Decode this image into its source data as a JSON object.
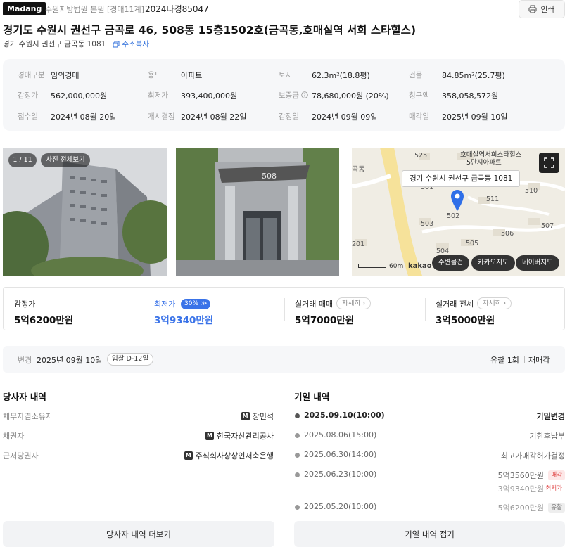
{
  "header": {
    "brand": "Madang",
    "court": "수원지방법원 본원 [경매11계]",
    "case_number": "2024타경85047",
    "print_label": "인쇄"
  },
  "property": {
    "title": "경기도 수원시 권선구 금곡로 46, 508동 15층1502호(금곡동,호매실역 서희 스타힐스)",
    "lot_address": "경기 수원시 권선구 금곡동 1081",
    "copy_label": "주소복사"
  },
  "info": [
    {
      "label": "경매구분",
      "value": "임의경매"
    },
    {
      "label": "용도",
      "value": "아파트"
    },
    {
      "label": "토지",
      "value": "62.3m²(18.8평)"
    },
    {
      "label": "건물",
      "value": "84.85m²(25.7평)"
    },
    {
      "label": "감정가",
      "value": "562,000,000원"
    },
    {
      "label": "최저가",
      "value": "393,400,000원"
    },
    {
      "label": "보증금",
      "value": "78,680,000원 (20%)"
    },
    {
      "label": "청구액",
      "value": "358,058,572원"
    },
    {
      "label": "접수일",
      "value": "2024년 08월 20일"
    },
    {
      "label": "개시결정",
      "value": "2024년 08월 22일"
    },
    {
      "label": "감정일",
      "value": "2024년 09월 09일"
    },
    {
      "label": "매각일",
      "value": "2025년 09월 10일"
    }
  ],
  "photos": {
    "counter": "1 / 11",
    "view_all": "사진 전체보기",
    "building_sign": "508"
  },
  "map": {
    "tooltip": "경기 수원시 권선구 금곡동 1081",
    "complex_label_1": "호매실역서희스타힐스",
    "complex_label_2": "5단지아파트",
    "area_label": "곡동",
    "buildings": [
      "525",
      "501",
      "510",
      "511",
      "503",
      "502",
      "507",
      "506",
      "201",
      "504",
      "505"
    ],
    "scale": "60m",
    "provider": "kakao",
    "buttons": [
      "주변물건",
      "카카오지도",
      "네이버지도"
    ]
  },
  "prices": {
    "appraisal_label": "감정가",
    "appraisal_value": "5억6200만원",
    "minimum_label": "최저가",
    "minimum_pct": "30%",
    "minimum_value": "3억9340만원",
    "trade_label": "실거래 매매",
    "trade_value": "5억7000만원",
    "jeonse_label": "실거래 전세",
    "jeonse_value": "3억5000만원",
    "detail_label": "자세히",
    "accent_color": "#3a73e8"
  },
  "status": {
    "change_label": "변경",
    "change_date": "2025년 09월 10일",
    "dday": "입찰 D-12일",
    "failed": "유찰 1회",
    "resale": "재매각"
  },
  "parties": {
    "title": "당사자 내역",
    "rows": [
      {
        "role": "채무자겸소유자",
        "name": "장민석",
        "badge": "M"
      },
      {
        "role": "채권자",
        "name": "한국자산관리공사",
        "badge": "M"
      },
      {
        "role": "근저당권자",
        "name": "주식회사상상인저축은행",
        "badge": "M"
      }
    ],
    "more_button": "당사자 내역 더보기"
  },
  "schedule": {
    "title": "기일 내역",
    "rows": [
      {
        "date": "2025.09.10(10:00)",
        "result": "기일변경"
      },
      {
        "date": "2025.08.06(15:00)",
        "result": "기한후납부"
      },
      {
        "date": "2025.06.30(14:00)",
        "result": "최고가매각허가결정"
      },
      {
        "date": "2025.06.23(10:00)",
        "result": "5억3560만원",
        "tag": "매각",
        "sub": "3억9340만원",
        "sub_tag": "최저가"
      },
      {
        "date": "2025.05.20(10:00)",
        "result": "5억6200만원",
        "tag": "유찰"
      }
    ],
    "collapse_button": "기일 내역 접기"
  }
}
